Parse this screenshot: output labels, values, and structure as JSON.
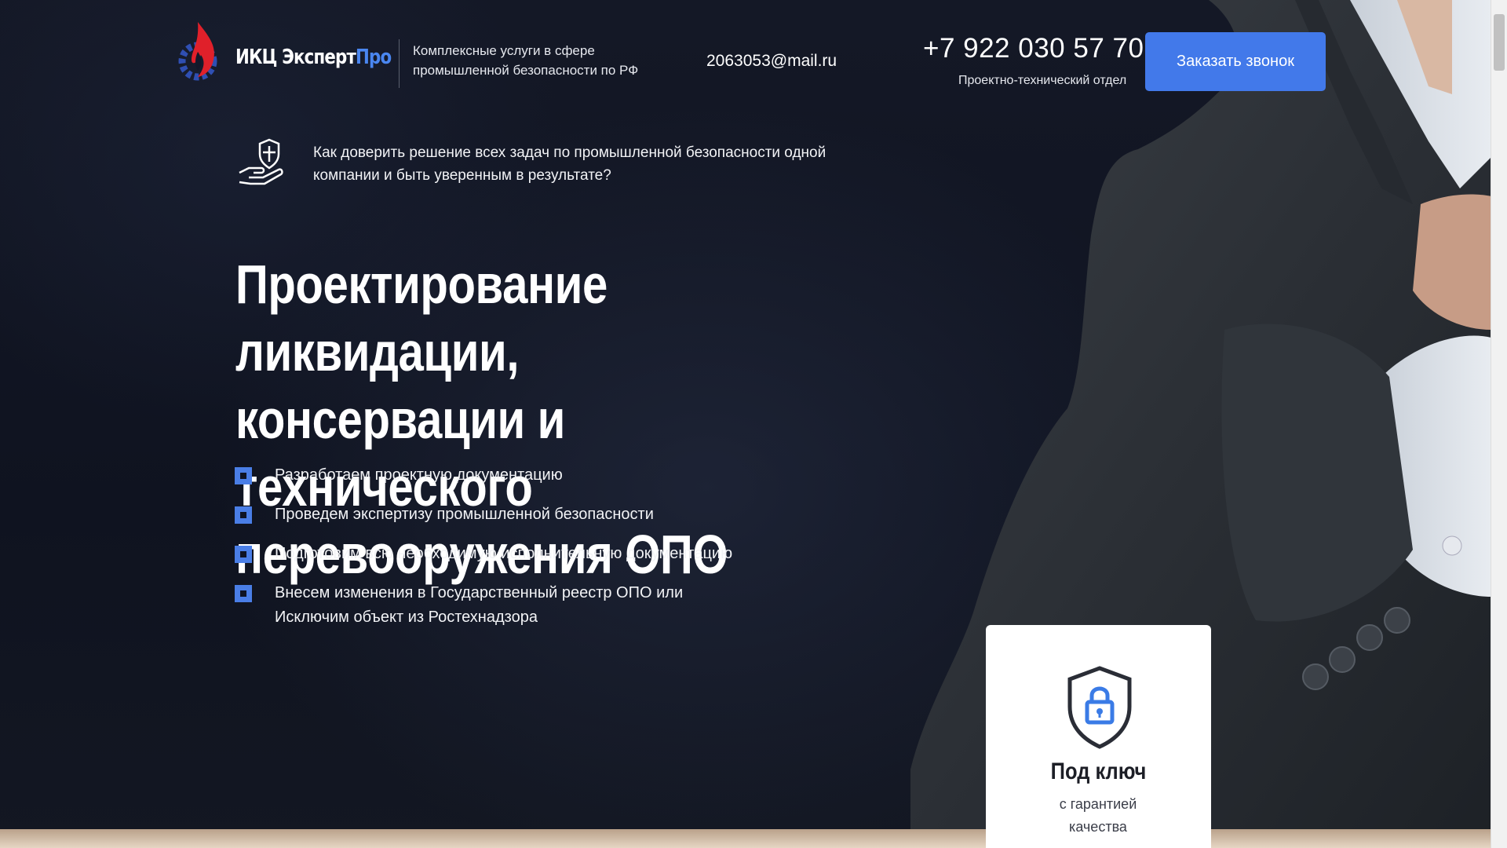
{
  "header": {
    "logo_text": "ИКЦ Эксперт",
    "logo_text_accent": "Про",
    "tagline": "Комплексные услуги в сфере промышленной безопасности по РФ",
    "email": "2063053@mail.ru",
    "phone": "+7 922 030 57 70",
    "department": "Проектно-технический отдел",
    "cta_label": "Заказать звонок",
    "cta_color": "#4279ea"
  },
  "hero": {
    "intro_icon": "hand-shield-icon",
    "intro": "Как доверить решение всех задач по промышленной безопасности одной компании и быть уверенным в результате?",
    "headline_line1": "Проектирование ликвидации,",
    "headline_line2": "консервации и технического",
    "headline_line3": "перевооружения ОПО",
    "features": [
      "Разработаем проектную документацию",
      "Проведем экспертизу промышленной безопасности",
      "Подготовим всю необходимую исполнительную документацию",
      "Внесем изменения в Государственный реестр ОПО или Исключим объект из Ростехнадзора"
    ],
    "bullet_color": "#4a7ee6"
  },
  "card": {
    "icon": "shield-lock-icon",
    "title": "Под ключ",
    "subtitle": "с гарантией качества"
  }
}
